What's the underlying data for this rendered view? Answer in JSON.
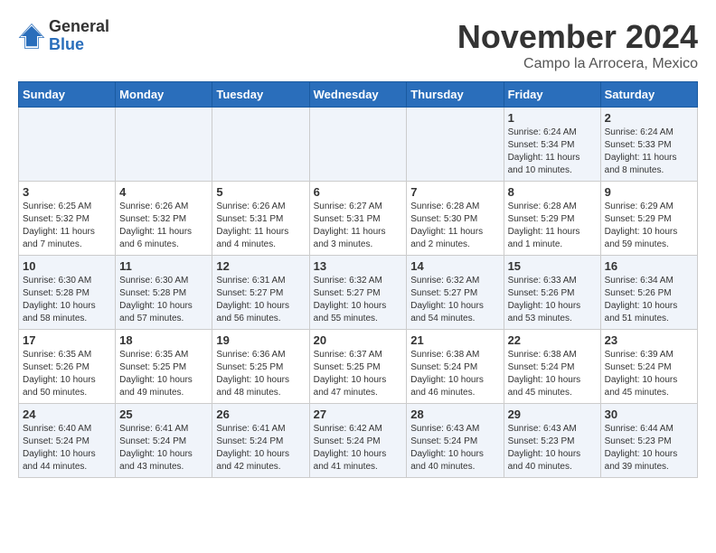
{
  "logo": {
    "general": "General",
    "blue": "Blue"
  },
  "title": "November 2024",
  "location": "Campo la Arrocera, Mexico",
  "weekdays": [
    "Sunday",
    "Monday",
    "Tuesday",
    "Wednesday",
    "Thursday",
    "Friday",
    "Saturday"
  ],
  "weeks": [
    [
      {
        "day": "",
        "info": ""
      },
      {
        "day": "",
        "info": ""
      },
      {
        "day": "",
        "info": ""
      },
      {
        "day": "",
        "info": ""
      },
      {
        "day": "",
        "info": ""
      },
      {
        "day": "1",
        "info": "Sunrise: 6:24 AM\nSunset: 5:34 PM\nDaylight: 11 hours and 10 minutes."
      },
      {
        "day": "2",
        "info": "Sunrise: 6:24 AM\nSunset: 5:33 PM\nDaylight: 11 hours and 8 minutes."
      }
    ],
    [
      {
        "day": "3",
        "info": "Sunrise: 6:25 AM\nSunset: 5:32 PM\nDaylight: 11 hours and 7 minutes."
      },
      {
        "day": "4",
        "info": "Sunrise: 6:26 AM\nSunset: 5:32 PM\nDaylight: 11 hours and 6 minutes."
      },
      {
        "day": "5",
        "info": "Sunrise: 6:26 AM\nSunset: 5:31 PM\nDaylight: 11 hours and 4 minutes."
      },
      {
        "day": "6",
        "info": "Sunrise: 6:27 AM\nSunset: 5:31 PM\nDaylight: 11 hours and 3 minutes."
      },
      {
        "day": "7",
        "info": "Sunrise: 6:28 AM\nSunset: 5:30 PM\nDaylight: 11 hours and 2 minutes."
      },
      {
        "day": "8",
        "info": "Sunrise: 6:28 AM\nSunset: 5:29 PM\nDaylight: 11 hours and 1 minute."
      },
      {
        "day": "9",
        "info": "Sunrise: 6:29 AM\nSunset: 5:29 PM\nDaylight: 10 hours and 59 minutes."
      }
    ],
    [
      {
        "day": "10",
        "info": "Sunrise: 6:30 AM\nSunset: 5:28 PM\nDaylight: 10 hours and 58 minutes."
      },
      {
        "day": "11",
        "info": "Sunrise: 6:30 AM\nSunset: 5:28 PM\nDaylight: 10 hours and 57 minutes."
      },
      {
        "day": "12",
        "info": "Sunrise: 6:31 AM\nSunset: 5:27 PM\nDaylight: 10 hours and 56 minutes."
      },
      {
        "day": "13",
        "info": "Sunrise: 6:32 AM\nSunset: 5:27 PM\nDaylight: 10 hours and 55 minutes."
      },
      {
        "day": "14",
        "info": "Sunrise: 6:32 AM\nSunset: 5:27 PM\nDaylight: 10 hours and 54 minutes."
      },
      {
        "day": "15",
        "info": "Sunrise: 6:33 AM\nSunset: 5:26 PM\nDaylight: 10 hours and 53 minutes."
      },
      {
        "day": "16",
        "info": "Sunrise: 6:34 AM\nSunset: 5:26 PM\nDaylight: 10 hours and 51 minutes."
      }
    ],
    [
      {
        "day": "17",
        "info": "Sunrise: 6:35 AM\nSunset: 5:26 PM\nDaylight: 10 hours and 50 minutes."
      },
      {
        "day": "18",
        "info": "Sunrise: 6:35 AM\nSunset: 5:25 PM\nDaylight: 10 hours and 49 minutes."
      },
      {
        "day": "19",
        "info": "Sunrise: 6:36 AM\nSunset: 5:25 PM\nDaylight: 10 hours and 48 minutes."
      },
      {
        "day": "20",
        "info": "Sunrise: 6:37 AM\nSunset: 5:25 PM\nDaylight: 10 hours and 47 minutes."
      },
      {
        "day": "21",
        "info": "Sunrise: 6:38 AM\nSunset: 5:24 PM\nDaylight: 10 hours and 46 minutes."
      },
      {
        "day": "22",
        "info": "Sunrise: 6:38 AM\nSunset: 5:24 PM\nDaylight: 10 hours and 45 minutes."
      },
      {
        "day": "23",
        "info": "Sunrise: 6:39 AM\nSunset: 5:24 PM\nDaylight: 10 hours and 45 minutes."
      }
    ],
    [
      {
        "day": "24",
        "info": "Sunrise: 6:40 AM\nSunset: 5:24 PM\nDaylight: 10 hours and 44 minutes."
      },
      {
        "day": "25",
        "info": "Sunrise: 6:41 AM\nSunset: 5:24 PM\nDaylight: 10 hours and 43 minutes."
      },
      {
        "day": "26",
        "info": "Sunrise: 6:41 AM\nSunset: 5:24 PM\nDaylight: 10 hours and 42 minutes."
      },
      {
        "day": "27",
        "info": "Sunrise: 6:42 AM\nSunset: 5:24 PM\nDaylight: 10 hours and 41 minutes."
      },
      {
        "day": "28",
        "info": "Sunrise: 6:43 AM\nSunset: 5:24 PM\nDaylight: 10 hours and 40 minutes."
      },
      {
        "day": "29",
        "info": "Sunrise: 6:43 AM\nSunset: 5:23 PM\nDaylight: 10 hours and 40 minutes."
      },
      {
        "day": "30",
        "info": "Sunrise: 6:44 AM\nSunset: 5:23 PM\nDaylight: 10 hours and 39 minutes."
      }
    ]
  ]
}
